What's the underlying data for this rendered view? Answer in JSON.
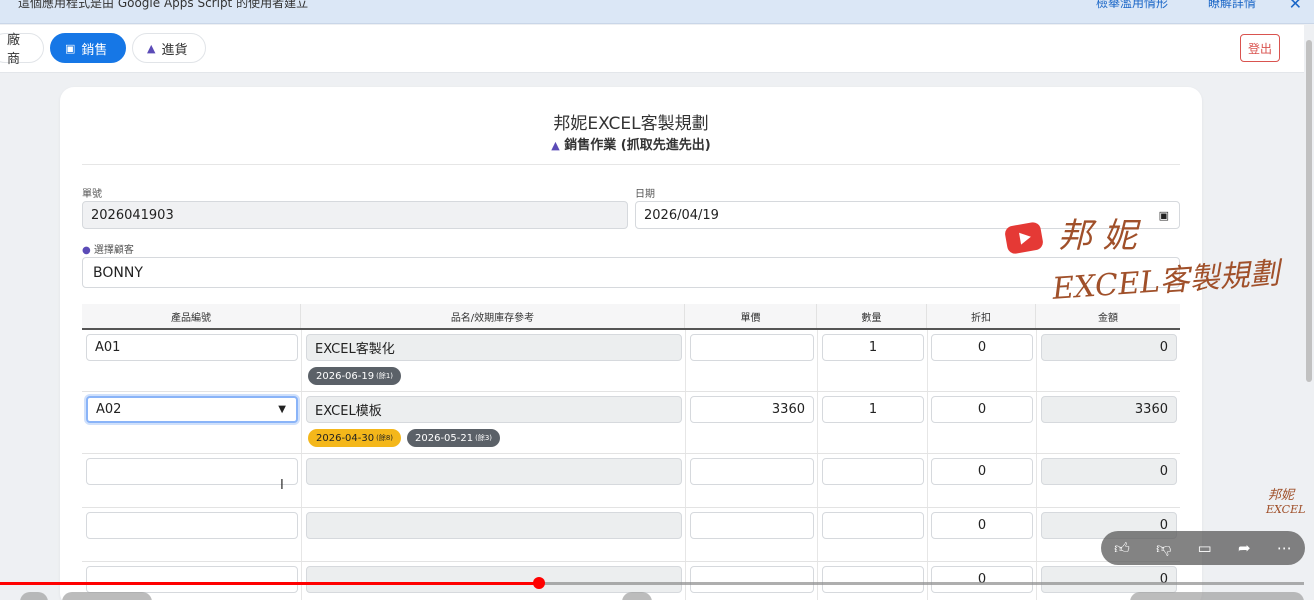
{
  "banner": {
    "message": "這個應用程式是由 Google Apps Script 的使用者建立",
    "report_link": "檢舉濫用情形",
    "details_link": "瞭解詳情",
    "close_icon": "close-icon"
  },
  "nav": {
    "tabs": [
      {
        "label": "廠商",
        "icon": ""
      },
      {
        "label": "銷售",
        "icon": "calendar-icon",
        "active": true
      },
      {
        "label": "進貨",
        "icon": "box-icon"
      }
    ],
    "logout": "登出"
  },
  "header": {
    "title": "邦妮EXCEL客製規劃",
    "subtitle": "銷售作業 (抓取先進先出)"
  },
  "form": {
    "order_label": "單號",
    "order_value": "2026041903",
    "date_label": "日期",
    "date_value": "2026/04/19",
    "customer_label": "選擇顧客",
    "customer_value": "BONNY"
  },
  "table": {
    "headers": [
      "產品編號",
      "品名/效期庫存參考",
      "單價",
      "數量",
      "折扣",
      "金額"
    ],
    "rows": [
      {
        "code": "A01",
        "name": "EXCEL客製化",
        "price": "",
        "qty": "1",
        "discount": "0",
        "amount": "0",
        "badges": [
          {
            "date": "2026-06-19",
            "remain": "(餘1)",
            "color": "grey"
          }
        ]
      },
      {
        "code": "A02",
        "name": "EXCEL模板",
        "price": "3360",
        "qty": "1",
        "discount": "0",
        "amount": "3360",
        "badges": [
          {
            "date": "2026-04-30",
            "remain": "(餘8)",
            "color": "yellow"
          },
          {
            "date": "2026-05-21",
            "remain": "(餘3)",
            "color": "grey"
          }
        ]
      },
      {
        "code": "",
        "name": "",
        "price": "",
        "qty": "",
        "discount": "0",
        "amount": "0",
        "badges": []
      },
      {
        "code": "",
        "name": "",
        "price": "",
        "qty": "",
        "discount": "0",
        "amount": "0",
        "badges": []
      },
      {
        "code": "",
        "name": "",
        "price": "",
        "qty": "",
        "discount": "0",
        "amount": "0",
        "badges": []
      }
    ]
  },
  "watermark": {
    "line1": "邦 妮",
    "line2": "EXCEL客製規劃",
    "small1": "邦妮",
    "small2": "EXCEL"
  },
  "colors": {
    "accent": "#1677e6",
    "danger": "#d9534f",
    "badge_yellow": "#f4b71a",
    "badge_grey": "#5b6168",
    "progress": "#ff0000"
  }
}
